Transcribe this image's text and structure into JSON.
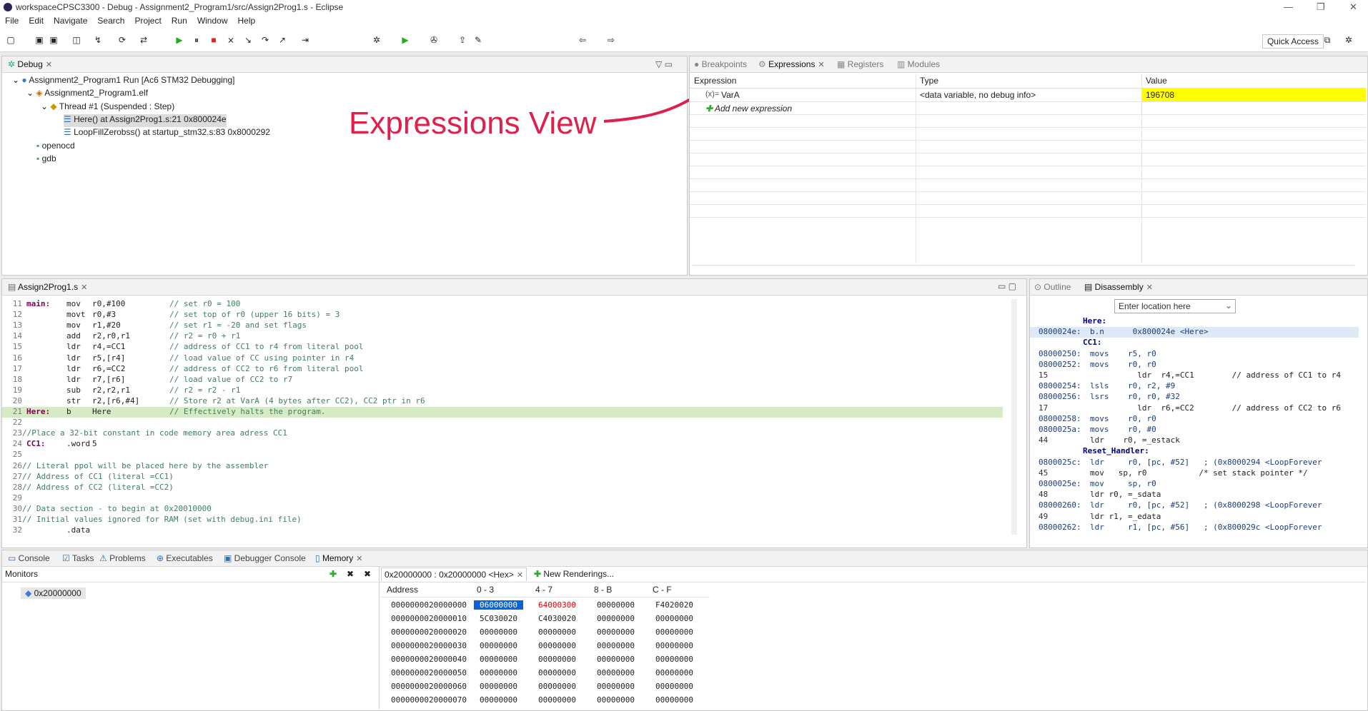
{
  "window": {
    "title": "workspaceCPSC3300 - Debug - Assignment2_Program1/src/Assign2Prog1.s - Eclipse"
  },
  "menu": [
    "File",
    "Edit",
    "Navigate",
    "Search",
    "Project",
    "Run",
    "Window",
    "Help"
  ],
  "toolbar": {
    "quick_access": "Quick Access"
  },
  "debug": {
    "tab": "Debug",
    "tree": [
      "Assignment2_Program1 Run [Ac6 STM32 Debugging]",
      "Assignment2_Program1.elf",
      "Thread #1 (Suspended : Step)",
      "Here() at Assign2Prog1.s:21 0x800024e",
      "LoopFillZerobss() at startup_stm32.s:83 0x8000292",
      "openocd",
      "gdb"
    ]
  },
  "annotation": {
    "text": "Expressions View"
  },
  "expressions": {
    "tabs": [
      "Breakpoints",
      "Expressions",
      "Registers",
      "Modules"
    ],
    "columns": [
      "Expression",
      "Type",
      "Value"
    ],
    "rows": [
      {
        "name": "VarA",
        "type": "<data variable, no debug info>",
        "value": "196708"
      }
    ],
    "add_label": "Add new expression"
  },
  "editor": {
    "tab": "Assign2Prog1.s",
    "lines": [
      {
        "n": "11",
        "label": "main:",
        "op": "mov",
        "args": "r0,#100",
        "comment": "// set r0 = 100"
      },
      {
        "n": "12",
        "label": "",
        "op": "movt",
        "args": "r0,#3",
        "comment": "// set top of r0 (upper 16 bits) = 3"
      },
      {
        "n": "13",
        "label": "",
        "op": "mov",
        "args": "r1,#20",
        "comment": "// set r1 = -20 and set flags"
      },
      {
        "n": "14",
        "label": "",
        "op": "add",
        "args": "r2,r0,r1",
        "comment": "// r2 = r0 + r1"
      },
      {
        "n": "15",
        "label": "",
        "op": "ldr",
        "args": "r4,=CC1",
        "comment": "// address of CC1 to r4 from literal pool"
      },
      {
        "n": "16",
        "label": "",
        "op": "ldr",
        "args": "r5,[r4]",
        "comment": "// load value of CC using pointer in r4"
      },
      {
        "n": "17",
        "label": "",
        "op": "ldr",
        "args": "r6,=CC2",
        "comment": "// address of CC2 to r6 from literal pool"
      },
      {
        "n": "18",
        "label": "",
        "op": "ldr",
        "args": "r7,[r6]",
        "comment": "// load value of CC2 to r7"
      },
      {
        "n": "19",
        "label": "",
        "op": "sub",
        "args": "r2,r2,r1",
        "comment": "// r2 = r2 - r1"
      },
      {
        "n": "20",
        "label": "",
        "op": "str",
        "args": "r2,[r6,#4]",
        "comment": "// Store r2 at VarA (4 bytes after CC2), CC2 ptr in r6"
      },
      {
        "n": "21",
        "label": "Here:",
        "op": "b",
        "args": "Here",
        "comment": "// Effectively halts the program."
      },
      {
        "n": "22",
        "label": "",
        "op": "",
        "args": "",
        "comment": ""
      },
      {
        "n": "23",
        "label": "",
        "op": "",
        "args": "",
        "comment": "//Place a 32-bit constant in code memory area adress CC1"
      },
      {
        "n": "24",
        "label": "CC1:",
        "op": ".word",
        "args": "5",
        "comment": ""
      },
      {
        "n": "25",
        "label": "",
        "op": "",
        "args": "",
        "comment": ""
      },
      {
        "n": "26",
        "label": "",
        "op": "",
        "args": "",
        "comment": "// Literal ppol will be placed here by the assembler"
      },
      {
        "n": "27",
        "label": "",
        "op": "",
        "args": "",
        "comment": "// Address of CC1 (literal =CC1)"
      },
      {
        "n": "28",
        "label": "",
        "op": "",
        "args": "",
        "comment": "// Address of CC2 (literal =CC2)"
      },
      {
        "n": "29",
        "label": "",
        "op": "",
        "args": "",
        "comment": ""
      },
      {
        "n": "30",
        "label": "",
        "op": "",
        "args": "",
        "comment": "// Data section - to begin at 0x20010000"
      },
      {
        "n": "31",
        "label": "",
        "op": "",
        "args": "",
        "comment": "// Initial values ignored for RAM (set with debug.ini file)"
      },
      {
        "n": "32",
        "label": "",
        "op": ".data",
        "args": "",
        "comment": ""
      }
    ]
  },
  "disassembly": {
    "tabs": [
      "Outline",
      "Disassembly"
    ],
    "location_placeholder": "Enter location here",
    "lines": [
      {
        "addr": "",
        "text": "Here:",
        "kind": "label"
      },
      {
        "addr": "0800024e:",
        "text": "b.n      0x800024e <Here>",
        "kind": "current"
      },
      {
        "addr": "",
        "text": "CC1:",
        "kind": "label"
      },
      {
        "addr": "08000250:",
        "text": "movs    r5, r0",
        "kind": "asm"
      },
      {
        "addr": "08000252:",
        "text": "movs    r0, r0",
        "kind": "asm"
      },
      {
        "addr": "15",
        "text": "          ldr  r4,=CC1        // address of CC1 to r4",
        "kind": "src"
      },
      {
        "addr": "08000254:",
        "text": "lsls    r0, r2, #9",
        "kind": "asm"
      },
      {
        "addr": "08000256:",
        "text": "lsrs    r0, r0, #32",
        "kind": "asm"
      },
      {
        "addr": "17",
        "text": "          ldr  r6,=CC2        // address of CC2 to r6",
        "kind": "src"
      },
      {
        "addr": "08000258:",
        "text": "movs    r0, r0",
        "kind": "asm"
      },
      {
        "addr": "0800025a:",
        "text": "movs    r0, #0",
        "kind": "asm"
      },
      {
        "addr": "44",
        "text": "ldr    r0, =_estack",
        "kind": "src"
      },
      {
        "addr": "",
        "text": "Reset_Handler:",
        "kind": "label"
      },
      {
        "addr": "0800025c:",
        "text": "ldr     r0, [pc, #52]   ; (0x8000294 <LoopForever",
        "kind": "asm"
      },
      {
        "addr": "45",
        "text": "mov   sp, r0           /* set stack pointer */",
        "kind": "src"
      },
      {
        "addr": "0800025e:",
        "text": "mov     sp, r0",
        "kind": "asm"
      },
      {
        "addr": "48",
        "text": "ldr r0, =_sdata",
        "kind": "src"
      },
      {
        "addr": "08000260:",
        "text": "ldr     r0, [pc, #52]   ; (0x8000298 <LoopForever",
        "kind": "asm"
      },
      {
        "addr": "49",
        "text": "ldr r1, =_edata",
        "kind": "src"
      },
      {
        "addr": "08000262:",
        "text": "ldr     r1, [pc, #56]   ; (0x800029c <LoopForever",
        "kind": "asm"
      }
    ]
  },
  "bottom_tabs": [
    "Console",
    "Tasks",
    "Problems",
    "Executables",
    "Debugger Console",
    "Memory"
  ],
  "memory": {
    "monitors_label": "Monitors",
    "monitor_item": "0x20000000",
    "rendering_tab": "0x20000000 : 0x20000000 <Hex>",
    "new_renderings": "New Renderings...",
    "columns": [
      "Address",
      "0 - 3",
      "4 - 7",
      "8 - B",
      "C - F"
    ],
    "rows": [
      [
        "0000000020000000",
        "06000000",
        "64000300",
        "00000000",
        "F4020020"
      ],
      [
        "0000000020000010",
        "5C030020",
        "C4030020",
        "00000000",
        "00000000"
      ],
      [
        "0000000020000020",
        "00000000",
        "00000000",
        "00000000",
        "00000000"
      ],
      [
        "0000000020000030",
        "00000000",
        "00000000",
        "00000000",
        "00000000"
      ],
      [
        "0000000020000040",
        "00000000",
        "00000000",
        "00000000",
        "00000000"
      ],
      [
        "0000000020000050",
        "00000000",
        "00000000",
        "00000000",
        "00000000"
      ],
      [
        "0000000020000060",
        "00000000",
        "00000000",
        "00000000",
        "00000000"
      ],
      [
        "0000000020000070",
        "00000000",
        "00000000",
        "00000000",
        "00000000"
      ]
    ]
  },
  "colors": {
    "highlight_yellow": "#ffff00",
    "annotation_red": "#e0204a",
    "changed_red": "#e00000",
    "selected_blue": "#0a64d8"
  }
}
